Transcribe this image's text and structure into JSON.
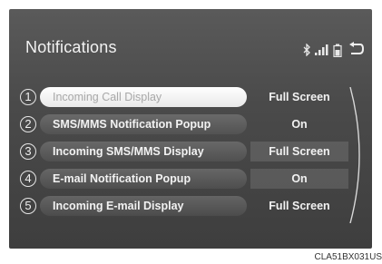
{
  "screen": {
    "title": "Notifications",
    "status_icons": [
      "bluetooth-icon",
      "signal-icon",
      "battery-icon"
    ],
    "back_icon": "back-arrow-icon"
  },
  "items": [
    {
      "number": "1",
      "label": "Incoming Call Display",
      "value": "Full Screen",
      "selected": true
    },
    {
      "number": "2",
      "label": "SMS/MMS Notification Popup",
      "value": "On",
      "selected": false
    },
    {
      "number": "3",
      "label": "Incoming SMS/MMS Display",
      "value": "Full Screen",
      "selected": false
    },
    {
      "number": "4",
      "label": "E-mail Notification Popup",
      "value": "On",
      "selected": false
    },
    {
      "number": "5",
      "label": "Incoming E-mail Display",
      "value": "Full Screen",
      "selected": false
    }
  ],
  "caption": "CLA51BX031US",
  "colors": {
    "screen_bg": "#4a4a4a",
    "text": "#f2f2f2",
    "selected_bg": "#ffffff"
  }
}
